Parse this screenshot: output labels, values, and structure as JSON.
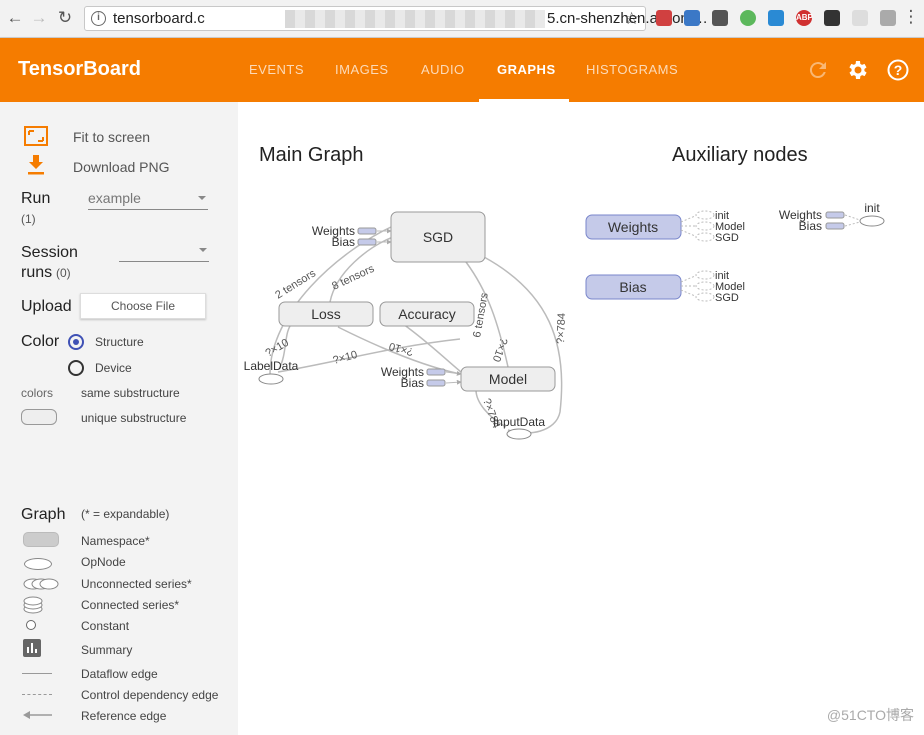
{
  "browser": {
    "url_prefix": "tensorboard.c",
    "url_suffix": "5.cn-shenzhen.alicont…"
  },
  "header": {
    "brand": "TensorBoard",
    "tabs": [
      {
        "label": "EVENTS"
      },
      {
        "label": "IMAGES"
      },
      {
        "label": "AUDIO"
      },
      {
        "label": "GRAPHS"
      },
      {
        "label": "HISTOGRAMS"
      }
    ],
    "active_tab": "GRAPHS",
    "accent_color": "#f57c00"
  },
  "sidebar": {
    "fit_to_screen": "Fit to screen",
    "download_png": "Download PNG",
    "run_label": "Run",
    "run_count": "(1)",
    "run_value": "example",
    "session_runs_label_1": "Session",
    "session_runs_label_2": "runs",
    "session_runs_count": "(0)",
    "upload_label": "Upload",
    "choose_file": "Choose File",
    "color_label": "Color",
    "color_options": [
      "Structure",
      "Device"
    ],
    "colors_label": "colors",
    "same_substructure": "same substructure",
    "unique_substructure": "unique substructure",
    "graph_label": "Graph",
    "expandable_hint": "(* = expandable)",
    "legend": [
      {
        "label": "Namespace*"
      },
      {
        "label": "OpNode"
      },
      {
        "label": "Unconnected series*"
      },
      {
        "label": "Connected series*"
      },
      {
        "label": "Constant"
      },
      {
        "label": "Summary"
      },
      {
        "label": "Dataflow edge"
      },
      {
        "label": "Control dependency edge"
      },
      {
        "label": "Reference edge"
      }
    ]
  },
  "main": {
    "main_graph_title": "Main Graph",
    "auxiliary_title": "Auxiliary nodes",
    "nodes": {
      "sgd": "SGD",
      "loss": "Loss",
      "accuracy": "Accuracy",
      "model": "Model",
      "label_data": "LabelData",
      "input_data": "InputData",
      "weights": "Weights",
      "bias": "Bias"
    },
    "edges": {
      "two_tensors": "2 tensors",
      "eight_tensors": "8 tensors",
      "six_tensors": "6 tensors",
      "q_x10_a": "?×10",
      "q_x10_b": "?×10",
      "q_x10_c": "?×10",
      "q_x10_d": "?×10",
      "q_x784_a": "?×784",
      "q_x784_b": "?×784"
    },
    "aux": {
      "weights": "Weights",
      "bias": "Bias",
      "init": "init",
      "model": "Model",
      "sgd": "SGD"
    },
    "watermark": "@51CTO博客"
  }
}
